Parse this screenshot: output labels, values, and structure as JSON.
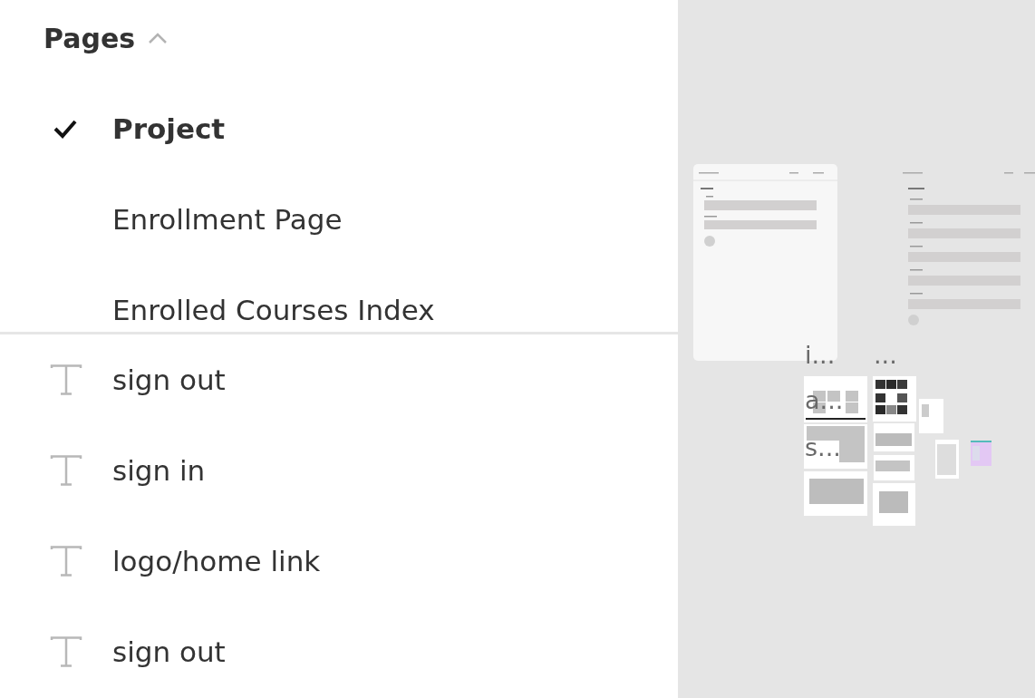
{
  "pages_panel": {
    "title": "Pages",
    "expanded": true
  },
  "pages": [
    {
      "label": "Project",
      "selected": true
    },
    {
      "label": "Enrollment Page",
      "selected": false
    },
    {
      "label": "Enrolled Courses Index",
      "selected": false
    }
  ],
  "layers": [
    {
      "label": "sign out",
      "kind": "text"
    },
    {
      "label": "sign in",
      "kind": "text"
    },
    {
      "label": "logo/home link",
      "kind": "text"
    },
    {
      "label": "sign out",
      "kind": "text"
    }
  ],
  "canvas": {
    "frame_labels": [
      "i...",
      "...",
      "a...",
      "s..."
    ]
  }
}
